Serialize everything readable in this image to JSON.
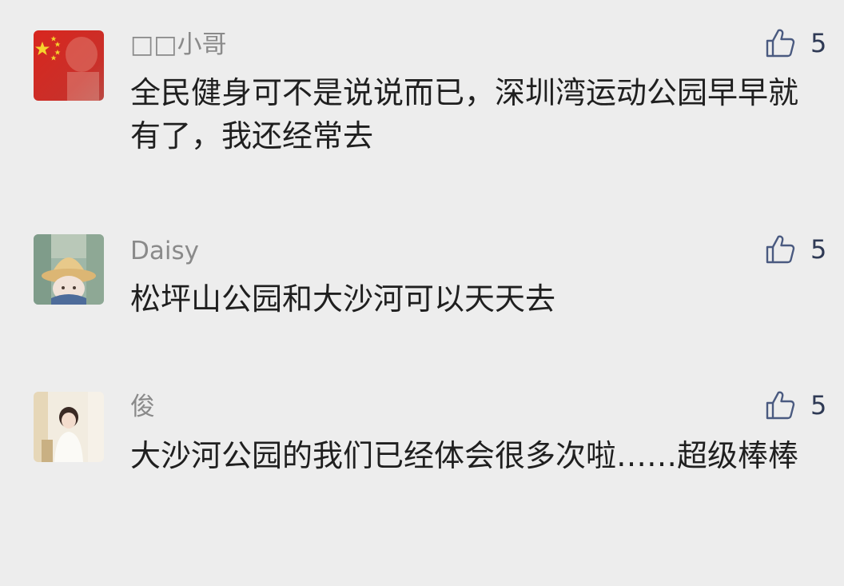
{
  "colors": {
    "background": "#ededed",
    "username": "#8a8a8a",
    "text": "#1f1f1f",
    "like_icon": "#4a5a80"
  },
  "comments": [
    {
      "username": "□□小哥",
      "text": "全民健身可不是说说而已，深圳湾运动公园早早就有了，我还经常去",
      "likes": "5",
      "avatar": "china-flag-avatar",
      "like_icon": "thumbs-up-icon"
    },
    {
      "username": "Daisy",
      "text": "松坪山公园和大沙河可以天天去",
      "likes": "5",
      "avatar": "straw-hat-avatar",
      "like_icon": "thumbs-up-icon"
    },
    {
      "username": "俊",
      "text": "大沙河公园的我们已经体会很多次啦……超级棒棒",
      "likes": "5",
      "avatar": "girl-portrait-avatar",
      "like_icon": "thumbs-up-icon"
    }
  ]
}
